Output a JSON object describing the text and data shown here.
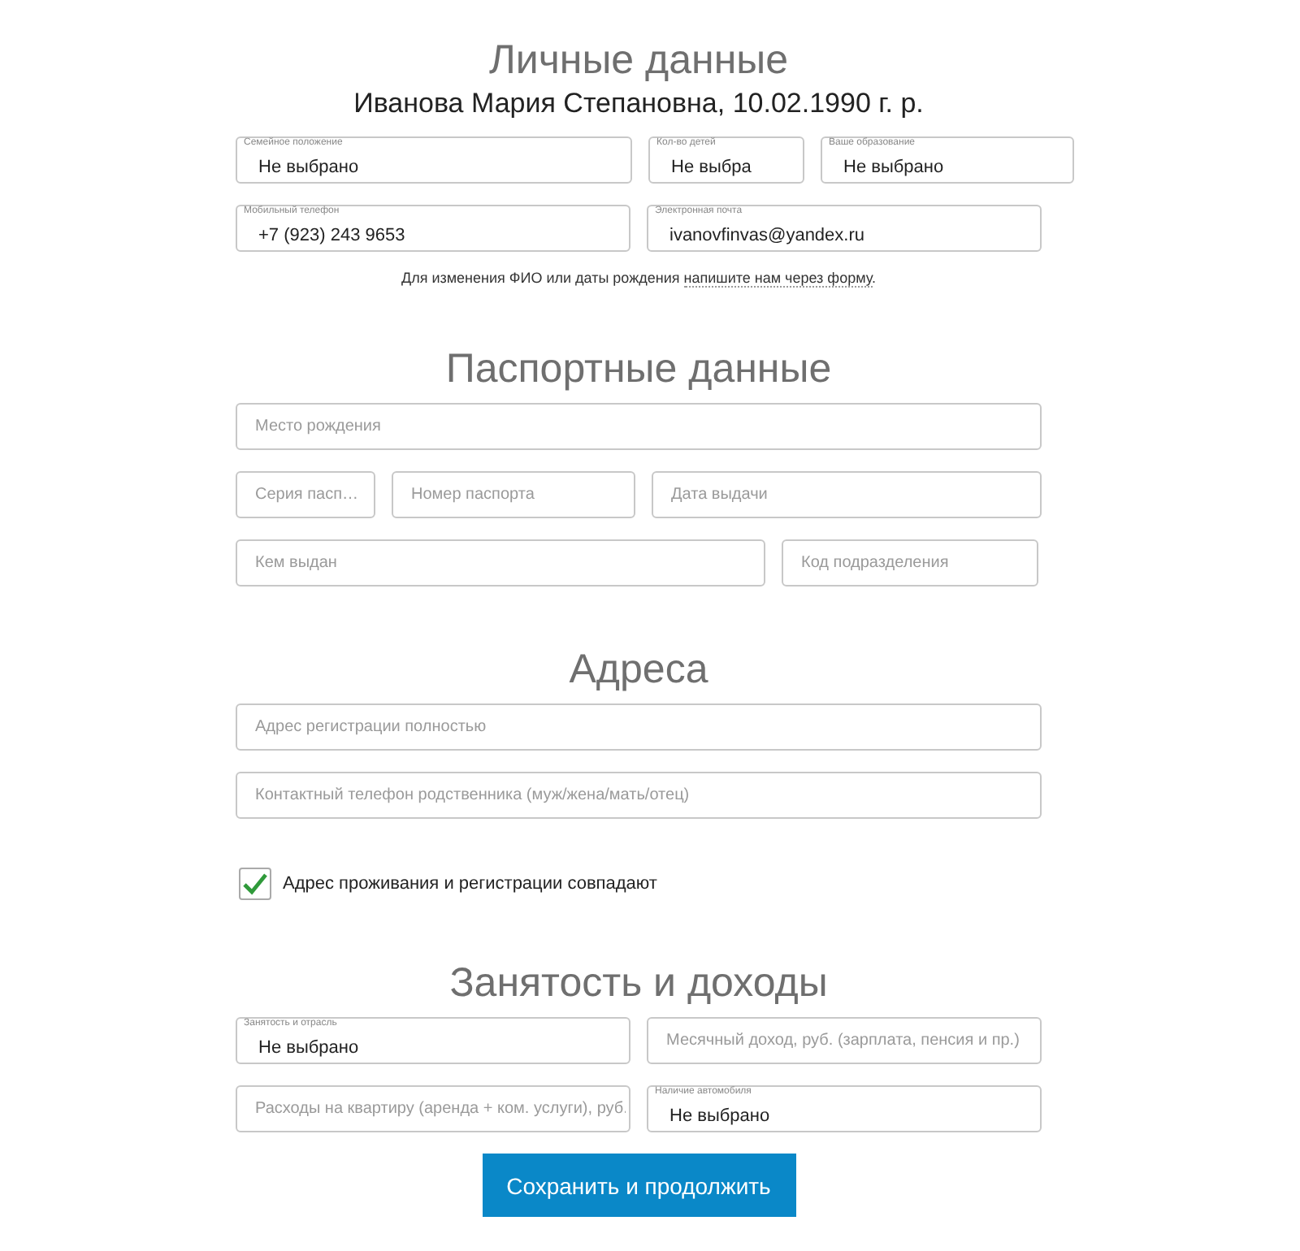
{
  "sections": [
    {
      "title": "Личные данные",
      "subtitle": "Иванова Мария Степановна, 10.02.1990 г. р.",
      "rows": [
        [
          {
            "label": "Семейное положение",
            "value": "Не выбрано"
          },
          {
            "label": "Кол-во детей",
            "value": "Не выбра"
          },
          {
            "label": "Ваше образование",
            "value": "Не выбрано"
          }
        ],
        [
          {
            "label": "Мобильный телефон",
            "value": "+7 (923) 243 9653"
          },
          {
            "label": "Электронная почта",
            "value": "ivanovfinvas@yandex.ru"
          }
        ]
      ],
      "note": {
        "text": "Для изменения ФИО или даты рождения ",
        "link": "напишите нам через форму",
        "after": "."
      }
    },
    {
      "title": "Паспортные данные",
      "rows": [
        [
          {
            "placeholder": "Место рождения"
          }
        ],
        [
          {
            "placeholder": "Серия пасп…"
          },
          {
            "placeholder": "Номер паспорта"
          },
          {
            "placeholder": "Дата выдачи"
          }
        ],
        [
          {
            "placeholder": "Кем выдан"
          },
          {
            "placeholder": "Код подразделения"
          }
        ]
      ]
    },
    {
      "title": "Адреса",
      "rows": [
        [
          {
            "placeholder": "Адрес регистрации полностью"
          }
        ],
        [
          {
            "placeholder": "Контактный телефон родственника (муж/жена/мать/отец)"
          }
        ]
      ],
      "checkbox": {
        "label": "Адрес проживания и регистрации совпадают",
        "checked": true
      }
    },
    {
      "title": "Занятость и доходы",
      "rows": [
        [
          {
            "label": "Занятость и отрасль",
            "value": "Не выбрано"
          },
          {
            "placeholder": "Месячный доход, руб. (зарплата, пенсия и пр.)"
          }
        ],
        [
          {
            "placeholder": "Расходы на квартиру (аренда + ком. услуги), руб."
          },
          {
            "label": "Наличие автомобиля",
            "value": "Не выбрано"
          }
        ]
      ]
    }
  ],
  "button": "Сохранить и продолжить"
}
